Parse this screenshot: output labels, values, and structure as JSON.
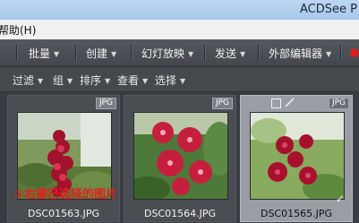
{
  "window": {
    "title": "ACDSee P"
  },
  "menubar": {
    "items": [
      "帮助(H)"
    ]
  },
  "toolbar": {
    "items": [
      {
        "label": "批量"
      },
      {
        "label": "创建"
      },
      {
        "label": "幻灯放映"
      },
      {
        "label": "发送"
      },
      {
        "label": "外部编辑器"
      }
    ]
  },
  "subbar": {
    "items": [
      {
        "label": "过滤"
      },
      {
        "label": "组"
      },
      {
        "label": "排序"
      },
      {
        "label": "查看"
      },
      {
        "label": "选择"
      }
    ]
  },
  "thumbnails": [
    {
      "filename": "DSC01563.JPG",
      "type": "JPG",
      "selected": false
    },
    {
      "filename": "DSC01564.JPG",
      "type": "JPG",
      "selected": false
    },
    {
      "filename": "DSC01565.JPG",
      "type": "JPG",
      "selected": true
    }
  ],
  "annotation": "①右键已选择的图片",
  "colors": {
    "annotation": "#e51d1d",
    "selected_bg": "#9a9ea4",
    "toolbar_bg": "#4b4e53"
  }
}
